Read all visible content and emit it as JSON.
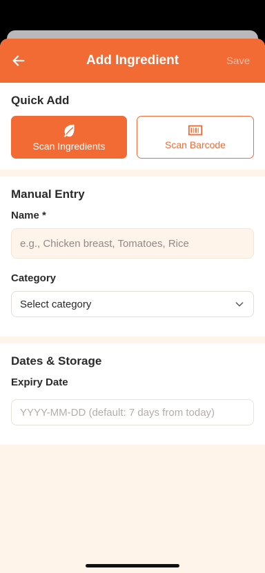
{
  "header": {
    "title": "Add Ingredient",
    "save_label": "Save",
    "back_icon": "arrow-left-icon"
  },
  "quick_add": {
    "title": "Quick Add",
    "scan_ingredients_label": "Scan Ingredients",
    "scan_ingredients_icon": "leaf-icon",
    "scan_barcode_label": "Scan Barcode",
    "scan_barcode_icon": "barcode-icon"
  },
  "manual_entry": {
    "title": "Manual Entry",
    "name_label": "Name *",
    "name_value": "",
    "name_placeholder": "e.g., Chicken breast, Tomatoes, Rice",
    "category_label": "Category",
    "category_value": "Select category"
  },
  "dates_storage": {
    "title": "Dates & Storage",
    "expiry_label": "Expiry Date",
    "expiry_value": "",
    "expiry_placeholder": "YYYY-MM-DD (default: 7 days from today)"
  },
  "colors": {
    "accent": "#f26b35",
    "background": "#fff4ea"
  }
}
